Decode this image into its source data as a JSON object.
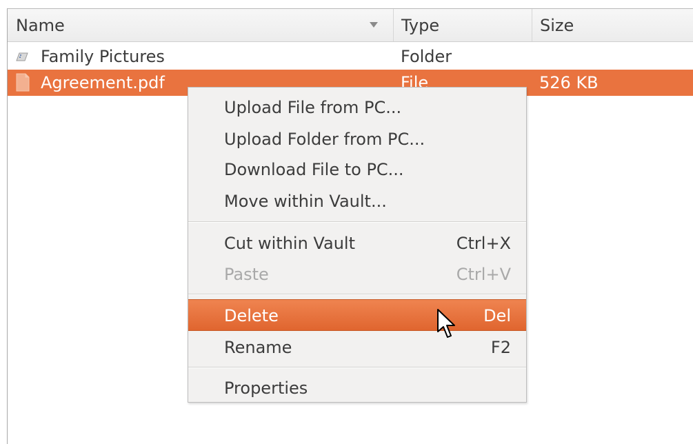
{
  "table": {
    "columns": {
      "name": "Name",
      "type": "Type",
      "size": "Size"
    },
    "sort_indicator": "chevron-down-icon",
    "rows": [
      {
        "icon": "folder-icon",
        "name": "Family Pictures",
        "type": "Folder",
        "size": "",
        "selected": false
      },
      {
        "icon": "file-icon",
        "name": "Agreement.pdf",
        "type": "File",
        "size": "526 KB",
        "selected": true
      }
    ]
  },
  "context_menu": {
    "items": [
      {
        "label": "Upload File from PC...",
        "shortcut": "",
        "enabled": true
      },
      {
        "label": "Upload Folder from PC...",
        "shortcut": "",
        "enabled": true
      },
      {
        "label": "Download File to PC...",
        "shortcut": "",
        "enabled": true
      },
      {
        "label": "Move within Vault...",
        "shortcut": "",
        "enabled": true
      },
      {
        "label": "Cut within Vault",
        "shortcut": "Ctrl+X",
        "enabled": true
      },
      {
        "label": "Paste",
        "shortcut": "Ctrl+V",
        "enabled": false
      },
      {
        "label": "Delete",
        "shortcut": "Del",
        "enabled": true,
        "highlighted": true
      },
      {
        "label": "Rename",
        "shortcut": "F2",
        "enabled": true
      },
      {
        "label": "Properties",
        "shortcut": "",
        "enabled": true
      }
    ]
  },
  "colors": {
    "selection": "#e9733f",
    "menu_background": "#f2f1f0",
    "text": "#3c3c3c",
    "disabled_text": "#a9a9a9"
  },
  "cursor": "arrow-pointer-icon"
}
